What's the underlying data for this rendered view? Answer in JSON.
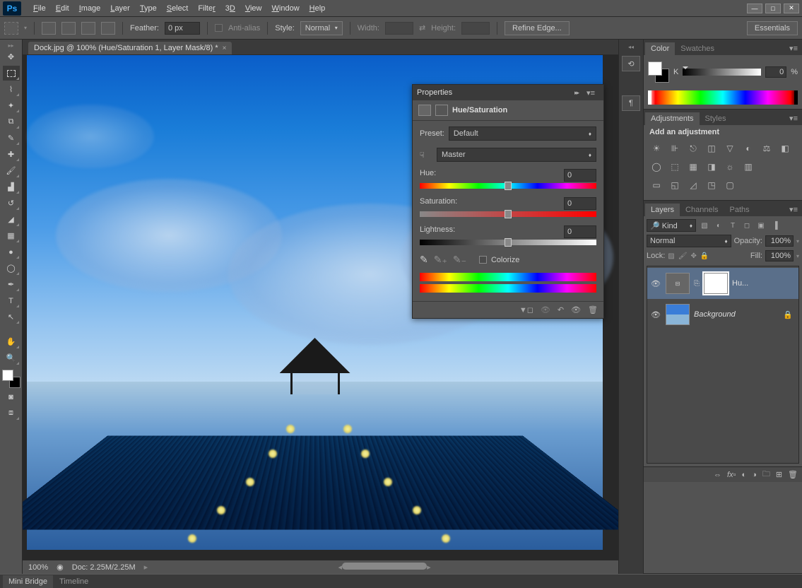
{
  "app": {
    "name": "Ps"
  },
  "menu": [
    "File",
    "Edit",
    "Image",
    "Layer",
    "Type",
    "Select",
    "Filter",
    "3D",
    "View",
    "Window",
    "Help"
  ],
  "optionsBar": {
    "feather_label": "Feather:",
    "feather_value": "0 px",
    "antialias": "Anti-alias",
    "style_label": "Style:",
    "style_value": "Normal",
    "width_label": "Width:",
    "height_label": "Height:",
    "refine": "Refine Edge...",
    "essentials": "Essentials"
  },
  "document": {
    "tab": "Dock.jpg @ 100% (Hue/Saturation 1, Layer Mask/8) *"
  },
  "status": {
    "zoom": "100%",
    "docinfo": "Doc: 2.25M/2.25M"
  },
  "bottomTabs": [
    "Mini Bridge",
    "Timeline"
  ],
  "colorPanel": {
    "tab1": "Color",
    "tab2": "Swatches",
    "channel": "K",
    "value": "0",
    "unit": "%"
  },
  "adjustments": {
    "tab1": "Adjustments",
    "tab2": "Styles",
    "heading": "Add an adjustment"
  },
  "layersPanel": {
    "tab1": "Layers",
    "tab2": "Channels",
    "tab3": "Paths",
    "filter": "Kind",
    "blend": "Normal",
    "opacity_label": "Opacity:",
    "opacity": "100%",
    "lock_label": "Lock:",
    "fill_label": "Fill:",
    "fill": "100%",
    "layer1": "Hu...",
    "layer2": "Background"
  },
  "properties": {
    "title": "Properties",
    "subtype": "Hue/Saturation",
    "preset_label": "Preset:",
    "preset_value": "Default",
    "range": "Master",
    "hue_label": "Hue:",
    "hue_value": "0",
    "sat_label": "Saturation:",
    "sat_value": "0",
    "lit_label": "Lightness:",
    "lit_value": "0",
    "colorize": "Colorize"
  }
}
